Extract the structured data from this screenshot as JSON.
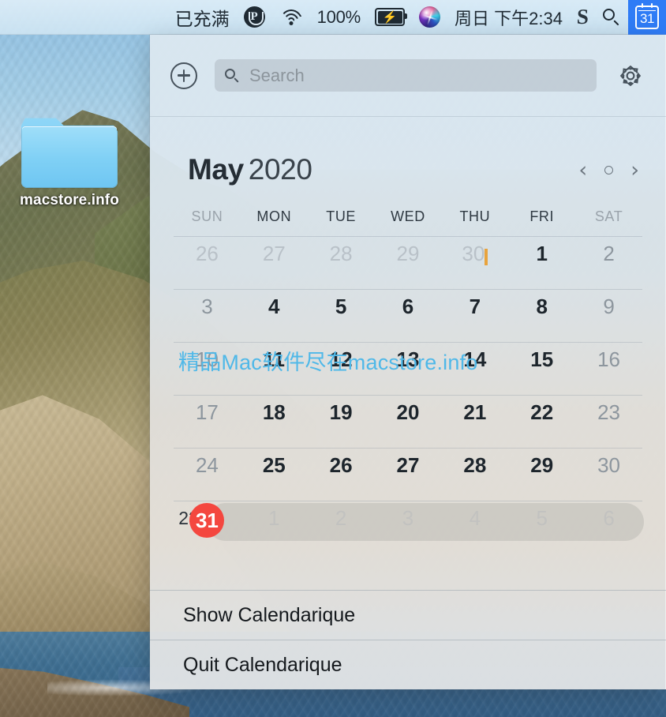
{
  "desktop": {
    "folder_label": "macstore.info",
    "folder_icon": "folder-icon"
  },
  "menubar": {
    "battery_status_text": "已充满",
    "parallels_icon": "parallels-desktop-icon",
    "wifi_icon": "wifi-icon",
    "battery_percent": "100%",
    "battery_icon": "battery-charging-icon",
    "siri_icon": "siri-icon",
    "clock": "周日 下午2:34",
    "input_method_icon": "sogou-input-icon",
    "spotlight_icon": "search-icon",
    "calendarique_icon": "calendar-31-icon",
    "calendarique_day": "31",
    "highlight_color": "#2f7cf6"
  },
  "panel": {
    "toolbar": {
      "add_icon": "plus-circle-icon",
      "search_icon": "search-icon",
      "search_placeholder": "Search",
      "search_value": "",
      "settings_icon": "gear-icon"
    },
    "header": {
      "month": "May",
      "year": "2020",
      "prev_icon": "chevron-left-icon",
      "today_icon": "circle-dot-icon",
      "next_icon": "chevron-right-icon"
    },
    "weekdays": [
      {
        "label": "SUN",
        "dim": true
      },
      {
        "label": "MON",
        "dim": false
      },
      {
        "label": "TUE",
        "dim": false
      },
      {
        "label": "WED",
        "dim": false
      },
      {
        "label": "THU",
        "dim": false
      },
      {
        "label": "FRI",
        "dim": false
      },
      {
        "label": "SAT",
        "dim": true
      }
    ],
    "weeks": [
      {
        "week_number": "",
        "highlighted": false,
        "days": [
          {
            "num": "26",
            "state": "other"
          },
          {
            "num": "27",
            "state": "other"
          },
          {
            "num": "28",
            "state": "other"
          },
          {
            "num": "29",
            "state": "other"
          },
          {
            "num": "30",
            "state": "other",
            "event": true
          },
          {
            "num": "1",
            "state": "normal"
          },
          {
            "num": "2",
            "state": "weekend"
          }
        ]
      },
      {
        "week_number": "",
        "highlighted": false,
        "days": [
          {
            "num": "3",
            "state": "weekend"
          },
          {
            "num": "4",
            "state": "normal"
          },
          {
            "num": "5",
            "state": "normal"
          },
          {
            "num": "6",
            "state": "normal"
          },
          {
            "num": "7",
            "state": "normal"
          },
          {
            "num": "8",
            "state": "normal"
          },
          {
            "num": "9",
            "state": "weekend"
          }
        ]
      },
      {
        "week_number": "",
        "highlighted": false,
        "days": [
          {
            "num": "10",
            "state": "weekend"
          },
          {
            "num": "11",
            "state": "normal"
          },
          {
            "num": "12",
            "state": "normal"
          },
          {
            "num": "13",
            "state": "normal"
          },
          {
            "num": "14",
            "state": "normal"
          },
          {
            "num": "15",
            "state": "normal"
          },
          {
            "num": "16",
            "state": "weekend"
          }
        ]
      },
      {
        "week_number": "",
        "highlighted": false,
        "days": [
          {
            "num": "17",
            "state": "weekend"
          },
          {
            "num": "18",
            "state": "normal"
          },
          {
            "num": "19",
            "state": "normal"
          },
          {
            "num": "20",
            "state": "normal"
          },
          {
            "num": "21",
            "state": "normal"
          },
          {
            "num": "22",
            "state": "normal"
          },
          {
            "num": "23",
            "state": "weekend"
          }
        ]
      },
      {
        "week_number": "",
        "highlighted": false,
        "days": [
          {
            "num": "24",
            "state": "weekend"
          },
          {
            "num": "25",
            "state": "normal"
          },
          {
            "num": "26",
            "state": "normal"
          },
          {
            "num": "27",
            "state": "normal"
          },
          {
            "num": "28",
            "state": "normal"
          },
          {
            "num": "29",
            "state": "normal"
          },
          {
            "num": "30",
            "state": "weekend"
          }
        ]
      },
      {
        "week_number": "23",
        "highlighted": true,
        "days": [
          {
            "num": "31",
            "state": "today"
          },
          {
            "num": "1",
            "state": "ghost"
          },
          {
            "num": "2",
            "state": "ghost"
          },
          {
            "num": "3",
            "state": "ghost"
          },
          {
            "num": "4",
            "state": "ghost"
          },
          {
            "num": "5",
            "state": "ghost"
          },
          {
            "num": "6",
            "state": "ghost"
          }
        ]
      }
    ],
    "menu": {
      "show_label": "Show Calendarique",
      "quit_label": "Quit Calendarique"
    },
    "today_color": "#f4473f",
    "event_color": "#e8a33d"
  },
  "watermark": {
    "text": "精品Mac软件尽在macstore.info",
    "color": "#4fb8e8"
  }
}
